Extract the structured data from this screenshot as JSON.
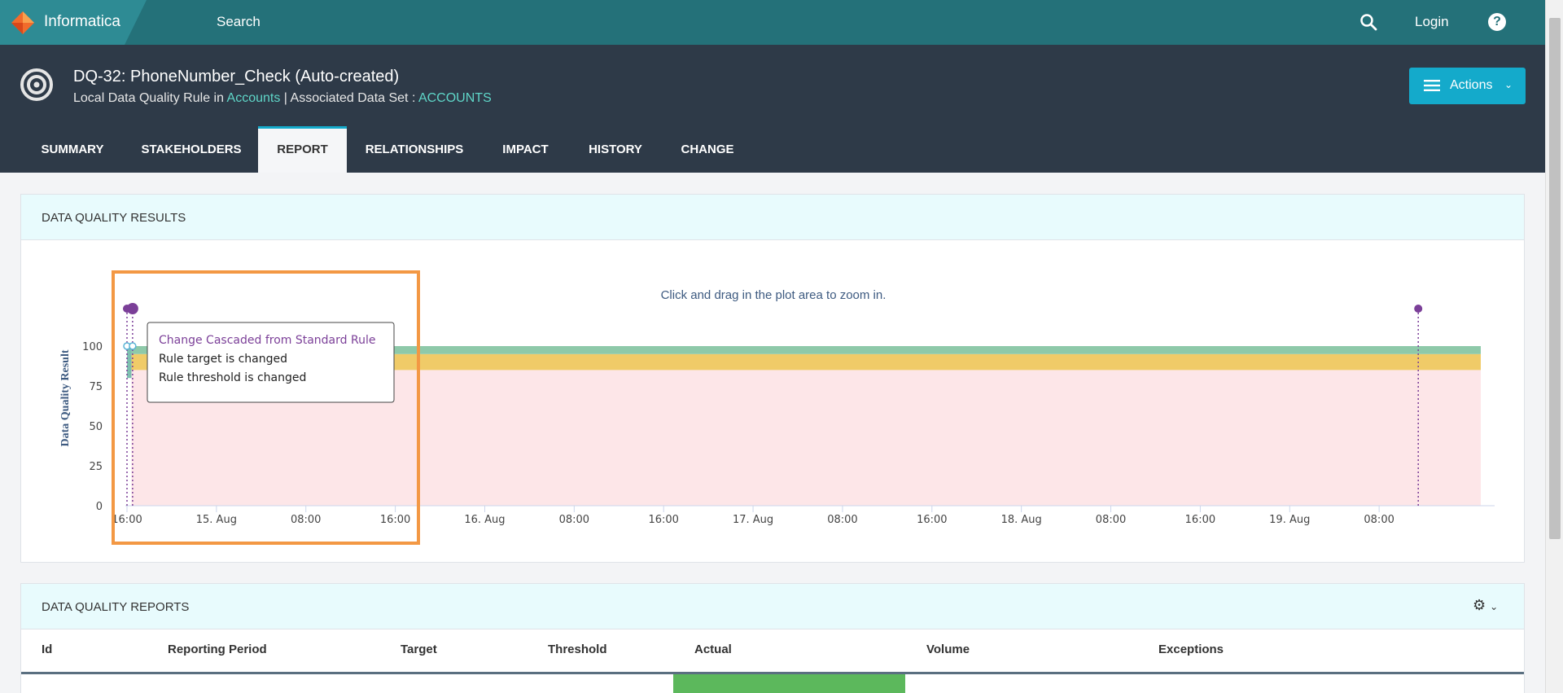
{
  "app": {
    "brand": "Informatica",
    "search_label": "Search",
    "login_label": "Login",
    "help_label": "?",
    "search_icon": "search-icon",
    "help_icon": "question-icon"
  },
  "asset": {
    "title": "DQ-32: PhoneNumber_Check (Auto-created)",
    "subtitle_prefix": "Local Data Quality Rule in ",
    "subtitle_link1": "Accounts",
    "subtitle_mid": " | Associated Data Set : ",
    "subtitle_link2": "ACCOUNTS",
    "actions_label": "Actions"
  },
  "tabs": [
    {
      "label": "SUMMARY"
    },
    {
      "label": "STAKEHOLDERS"
    },
    {
      "label": "REPORT",
      "active": true
    },
    {
      "label": "RELATIONSHIPS"
    },
    {
      "label": "IMPACT"
    },
    {
      "label": "HISTORY"
    },
    {
      "label": "CHANGE"
    }
  ],
  "results_panel": {
    "title": "DATA QUALITY RESULTS"
  },
  "chart_data": {
    "type": "area",
    "hint": "Click and drag in the plot area to zoom in.",
    "ylabel": "Data Quality Result",
    "ylim": [
      0,
      100
    ],
    "y_ticks": [
      "0",
      "25",
      "50",
      "75",
      "100"
    ],
    "x_ticks": [
      "16:00",
      "15. Aug",
      "08:00",
      "16:00",
      "16. Aug",
      "08:00",
      "16:00",
      "17. Aug",
      "08:00",
      "16:00",
      "18. Aug",
      "08:00",
      "16:00",
      "19. Aug",
      "08:00"
    ],
    "bands": [
      {
        "name": "below-threshold",
        "from": 0,
        "to": 85,
        "color": "#fde6e8"
      },
      {
        "name": "threshold-to-target",
        "from": 85,
        "to": 95,
        "color": "#f0cb68"
      },
      {
        "name": "above-target",
        "from": 95,
        "to": 100,
        "color": "#8ec9a9"
      }
    ],
    "event_markers": [
      {
        "x_hours": 0.0,
        "color": "#7b3f98"
      },
      {
        "x_hours": 0.5,
        "color": "#7b3f98"
      },
      {
        "x_hours": 115.5,
        "color": "#7b3f98"
      }
    ],
    "data_points": [
      {
        "x_hours": 0.0,
        "y": 100
      },
      {
        "x_hours": 0.5,
        "y": 100
      }
    ],
    "tooltip": {
      "title": "Change Cascaded from Standard Rule",
      "lines": [
        "Rule target is changed",
        "Rule threshold is changed"
      ]
    },
    "colors": {
      "marker": "#7b3f98",
      "point": "#5ab4d6",
      "highlight": "#f39844"
    }
  },
  "reports_panel": {
    "title": "DATA QUALITY REPORTS",
    "settings_icon": "gear-icon",
    "columns": [
      "Id",
      "Reporting Period",
      "Target",
      "Threshold",
      "Actual",
      "Volume",
      "Exceptions"
    ]
  }
}
